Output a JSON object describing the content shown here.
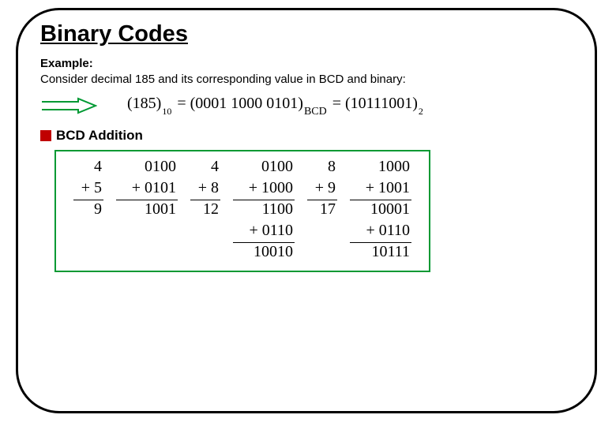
{
  "title": "Binary Codes",
  "example_label": "Example:",
  "example_text": "Consider decimal 185 and its corresponding value in BCD and binary:",
  "equation": {
    "lhs_val": "(185)",
    "lhs_sub": "10",
    "eq1": " = ",
    "mid_val": "(0001 1000 0101)",
    "mid_sub": "BCD",
    "eq2": " = ",
    "rhs_val": "(10111001)",
    "rhs_sub": "2"
  },
  "section_label": "BCD Addition",
  "table": {
    "r1": {
      "d1": "4",
      "b1": "0100",
      "d2": "4",
      "b2": "0100",
      "d3": "8",
      "b3": "1000"
    },
    "r2": {
      "d1": "+ 5",
      "b1": "+ 0101",
      "d2": "+ 8",
      "b2": "+ 1000",
      "d3": "+ 9",
      "b3": "+ 1001"
    },
    "r3": {
      "d1": "9",
      "b1": "1001",
      "d2": "12",
      "b2": "1100",
      "d3": "17",
      "b3": "10001"
    },
    "r4": {
      "b2": "+ 0110",
      "b3": "+ 0110"
    },
    "r5": {
      "b2": "10010",
      "b3": "10111"
    }
  }
}
